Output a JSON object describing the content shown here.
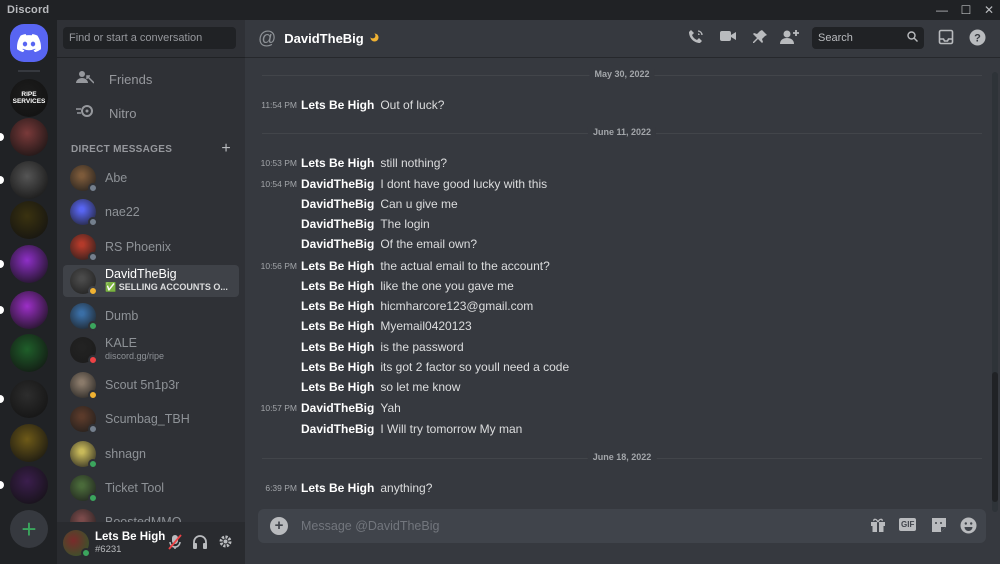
{
  "app": {
    "title": "Discord"
  },
  "window": {
    "minimize": "—",
    "maximize": "☐",
    "close": "✕"
  },
  "servers": {
    "items": [
      {
        "name": "RIPE SERVICES",
        "label": "RIPE\nSERVICES",
        "color": "#1d1d1d",
        "text": "#ffffff"
      },
      {
        "name": "server-2",
        "label": "",
        "color": "#7a3a3a"
      },
      {
        "name": "server-3",
        "label": "",
        "color": "#555555"
      },
      {
        "name": "server-4",
        "label": "",
        "color": "#3a3210"
      },
      {
        "name": "server-5",
        "label": "",
        "color": "#8e2fc7"
      },
      {
        "name": "server-6",
        "label": "",
        "color": "#9c2fc7"
      },
      {
        "name": "server-7",
        "label": "",
        "color": "#1f5f2a"
      },
      {
        "name": "server-8",
        "label": "",
        "color": "#2d2d2d"
      },
      {
        "name": "server-9",
        "label": "",
        "color": "#6e5a18"
      },
      {
        "name": "server-10",
        "label": "",
        "color": "#3b1e4d"
      }
    ],
    "add": "+"
  },
  "dm_panel": {
    "search_placeholder": "Find or start a conversation",
    "nav": {
      "friends": "Friends",
      "nitro": "Nitro"
    },
    "header": "DIRECT MESSAGES",
    "header_add": "+",
    "dms": [
      {
        "name": "Abe",
        "sub": "",
        "color": "#7c5a3a",
        "status": "#747f8d"
      },
      {
        "name": "nae22",
        "sub": "",
        "color": "#5865f2",
        "status": "#747f8d"
      },
      {
        "name": "RS Phoenix",
        "sub": "",
        "color": "#b33a2a",
        "status": "#747f8d"
      },
      {
        "name": "DavidTheBig",
        "sub": "✅ SELLING ACCOUNTS O...",
        "color": "#4a4a4a",
        "status": "#f0b232"
      },
      {
        "name": "Dumb",
        "sub": "",
        "color": "#3a6ea5",
        "status": "#3ba55d"
      },
      {
        "name": "KALE",
        "sub": "discord.gg/ripe",
        "color": "#222222",
        "status": "#ed4245"
      },
      {
        "name": "Scout 5n1p3r",
        "sub": "",
        "color": "#8a7a6a",
        "status": "#f0b232"
      },
      {
        "name": "Scumbag_TBH",
        "sub": "",
        "color": "#5a3a2a",
        "status": "#747f8d"
      },
      {
        "name": "shnagn",
        "sub": "",
        "color": "#c8b95a",
        "status": "#3ba55d"
      },
      {
        "name": "Ticket Tool",
        "sub": "",
        "color": "#4a6a3a",
        "status": "#3ba55d"
      },
      {
        "name": "BoostedMMO",
        "sub": "",
        "color": "#7a4a4a",
        "status": "#747f8d"
      }
    ]
  },
  "user": {
    "name": "Lets Be High",
    "tag": "#6231"
  },
  "chat": {
    "at": "@",
    "title": "DavidTheBig",
    "search_placeholder": "Search",
    "composer_placeholder": "Message @DavidTheBig",
    "gif_label": "GIF",
    "dividers": [
      "May 30, 2022",
      "June 11, 2022",
      "June 18, 2022"
    ],
    "messages": [
      {
        "time": "11:54 PM",
        "author": "Lets Be High",
        "content": "Out of luck?"
      },
      {
        "time": "10:53 PM",
        "author": "Lets Be High",
        "content": "still nothing?"
      },
      {
        "time": "10:54 PM",
        "author": "DavidTheBig",
        "content": "I dont have good lucky with this"
      },
      {
        "time": "",
        "author": "DavidTheBig",
        "content": "Can u give me"
      },
      {
        "time": "",
        "author": "DavidTheBig",
        "content": "The login"
      },
      {
        "time": "",
        "author": "DavidTheBig",
        "content": "Of the email own?"
      },
      {
        "time": "10:56 PM",
        "author": "Lets Be High",
        "content": "the actual email to the account?"
      },
      {
        "time": "",
        "author": "Lets Be High",
        "content": "like the one you gave me"
      },
      {
        "time": "",
        "author": "Lets Be High",
        "content": "hicmharcore123@gmail.com"
      },
      {
        "time": "",
        "author": "Lets Be High",
        "content": "Myemail0420123"
      },
      {
        "time": "",
        "author": "Lets Be High",
        "content": "is the password"
      },
      {
        "time": "",
        "author": "Lets Be High",
        "content": "its got 2 factor so youll need a code"
      },
      {
        "time": "",
        "author": "Lets Be High",
        "content": "so let me know"
      },
      {
        "time": "10:57 PM",
        "author": "DavidTheBig",
        "content": "Yah"
      },
      {
        "time": "",
        "author": "DavidTheBig",
        "content": "I Will try tomorrow My man"
      },
      {
        "time": "6:39 PM",
        "author": "Lets Be High",
        "content": "anything?"
      }
    ]
  },
  "colors": {
    "accent": "#5865f2",
    "online": "#3ba55d",
    "idle": "#f0b232",
    "dnd": "#ed4245",
    "offline": "#747f8d"
  }
}
